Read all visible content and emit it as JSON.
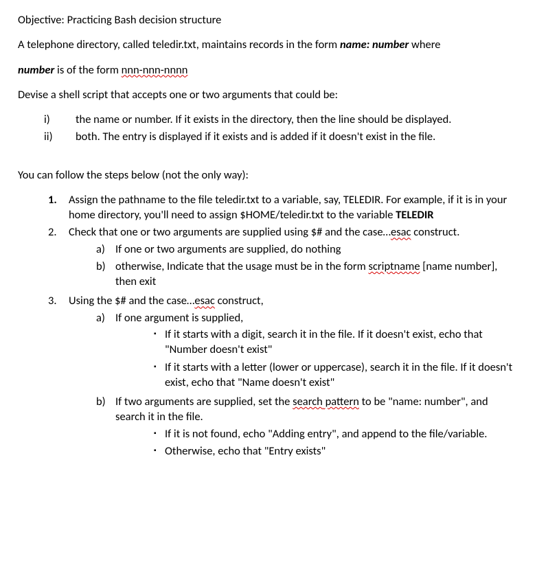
{
  "objective": "Objective: Practicing Bash decision structure",
  "intro": {
    "p1_a": "A telephone directory, called teledir.txt, maintains records in the form ",
    "p1_b": "name: number",
    "p1_c": " where",
    "p2_a": "number",
    "p2_b": " is of the form ",
    "p2_c": "nnn-nnn-nnnn",
    "p3": "Devise a shell script that accepts one or two arguments that could be:"
  },
  "roman": {
    "i_marker": "i)",
    "i_text": "the name or number. If it exists in the directory, then the line should be displayed.",
    "ii_marker": "ii)",
    "ii_text": "both. The entry is displayed if it exists and is added if it doesn't exist in the file."
  },
  "steps_intro": "You can follow the steps below (not the only way):",
  "step1": {
    "marker": "1.",
    "t1": "Assign the pathname to the file teledir.txt to a variable, say, TELEDIR. For example, if it is in your home directory, you'll need to assign $HOME/teledir.txt to the variable ",
    "t2": "TELEDIR"
  },
  "step2": {
    "marker": "2.",
    "t1": "Check that one or two arguments are supplied using $# and the case…",
    "t2": "esac",
    "t3": " construct.",
    "a_marker": "a)",
    "a_text": "If one or two arguments are supplied, do nothing",
    "b_marker": "b)",
    "b_t1": "otherwise, Indicate that the usage must be in the form ",
    "b_t2": "scriptname",
    "b_t3": " [name number], then exit"
  },
  "step3": {
    "marker": "3.",
    "t1": "Using the $# and the case…",
    "t2": "esac",
    "t3": " construct,",
    "a_marker": "a)",
    "a_text": "If one argument is supplied,",
    "a_b1": "If it starts with a digit, search it in the file. If it doesn't exist, echo that \"Number doesn't exist\"",
    "a_b2": "If it starts with a letter (lower or uppercase), search it in the file. If it doesn't exist, echo that \"Name doesn't exist\"",
    "b_marker": "b)",
    "b_t1": "If two arguments are supplied, set the ",
    "b_t2": "search",
    "b_t2b": " pattern",
    "b_t3": " to be \"name: number\", and search it in the file.",
    "b_b1": "If it is not found, echo \"Adding entry\", and append to the file/variable.",
    "b_b2": "Otherwise, echo that \"Entry exists\""
  },
  "glyphs": {
    "square": "▪"
  }
}
